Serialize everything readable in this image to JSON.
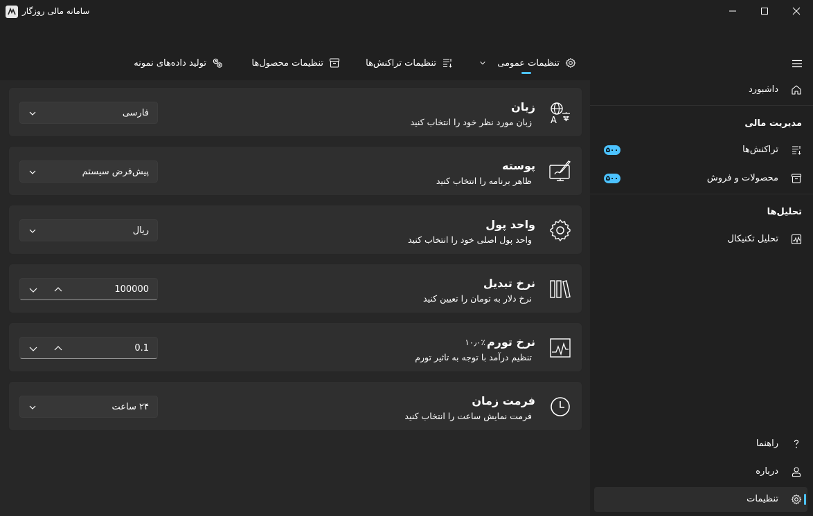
{
  "window": {
    "title": "سامانه مالی روزگار",
    "minimize_icon": "minimize-icon",
    "maximize_icon": "maximize-icon",
    "close_icon": "close-icon"
  },
  "tabs": [
    {
      "label": "تنظیمات عمومی",
      "icon": "gear-icon",
      "selected": true
    },
    {
      "label": "تنظیمات تراکنش‌ها",
      "icon": "list-icon"
    },
    {
      "label": "تنظیمات محصول‌ها",
      "icon": "archive-icon"
    },
    {
      "label": "تولید داده‌های نمونه",
      "icon": "gears-icon"
    }
  ],
  "settings": [
    {
      "title": "زبان",
      "subtitle": "زبان مورد نظر خود را انتخاب کنید",
      "control": "combo",
      "value": "فارسی",
      "icon": "translate-icon"
    },
    {
      "title": "پوسته",
      "subtitle": "ظاهر برنامه را انتخاب کنید",
      "control": "combo",
      "value": "پیش‌فرض سیستم",
      "icon": "theme-brush-icon"
    },
    {
      "title": "واحد پول",
      "subtitle": "واحد پول اصلی خود را انتخاب کنید",
      "control": "combo",
      "value": "ریال",
      "icon": "gear-icon"
    },
    {
      "title": "نرخ تبدیل",
      "subtitle": "نرخ دلار به تومان را تعیین کنید",
      "control": "number",
      "value": "100000",
      "icon": "library-icon"
    },
    {
      "title": "نرخ تورم",
      "badge": "۱۰٫۰٪",
      "subtitle": "تنظیم درآمد با توجه به تاثیر تورم",
      "control": "number",
      "value": "0.1",
      "icon": "chart-icon"
    },
    {
      "title": "فرمت زمان",
      "subtitle": "فرمت نمایش ساعت را انتخاب کنید",
      "control": "combo",
      "value": "۲۴ ساعت",
      "icon": "clock-icon"
    }
  ],
  "sidebar": {
    "menu_icon": "hamburger-icon",
    "dashboard": "داشبورد",
    "section_finance": "مدیریت مالی",
    "transactions": "تراکنش‌ها",
    "transactions_badge": "۵۰۰",
    "products": "محصولات و فروش",
    "products_badge": "۵۰۰",
    "section_analysis": "تحلیل‌ها",
    "technical": "تحلیل تکنیکال",
    "help": "راهنما",
    "about": "درباره",
    "settings": "تنظیمات"
  },
  "colors": {
    "accent": "#4cc2ff",
    "background": "#202020",
    "card": "#2f2f2f"
  }
}
